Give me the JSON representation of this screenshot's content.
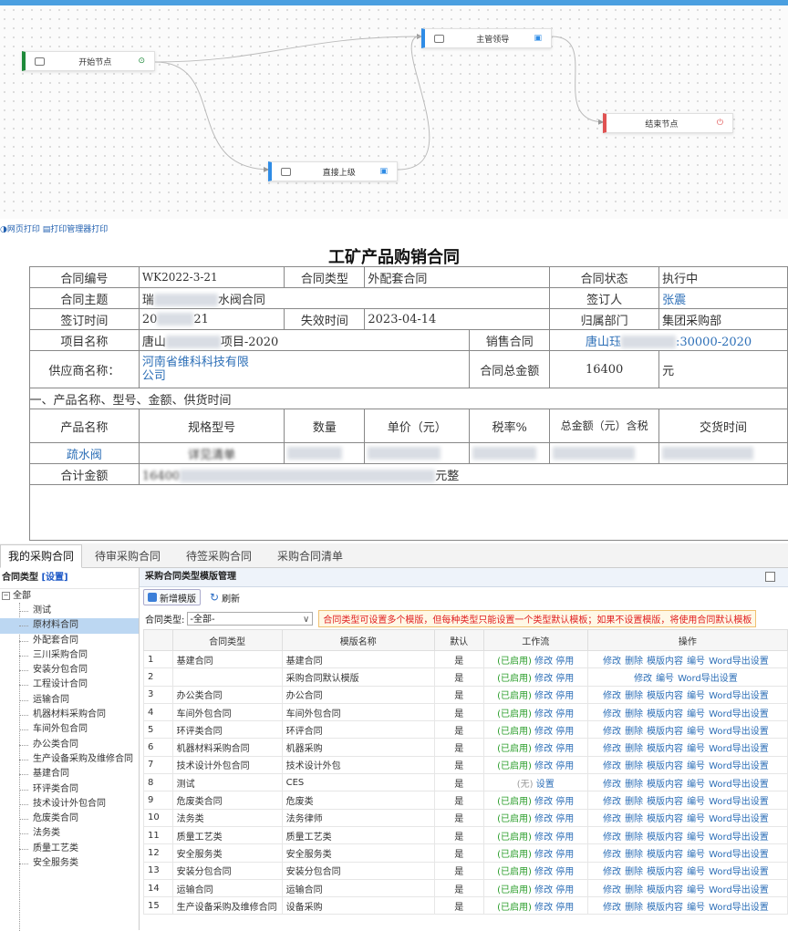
{
  "flow": {
    "nodes": [
      {
        "label": "开始节点",
        "kind": "start"
      },
      {
        "label": "主管领导",
        "kind": "task"
      },
      {
        "label": "结束节点",
        "kind": "end"
      },
      {
        "label": "直接上级",
        "kind": "task"
      }
    ],
    "colors": {
      "start": "#1e8a3a",
      "task": "#2f8ce6",
      "end": "#e05252"
    }
  },
  "print": {
    "web_print": "网页打印",
    "manager_print": "打印管理器打印"
  },
  "contract": {
    "title": "工矿产品购销合同",
    "labels": {
      "no": "合同编号",
      "type": "合同类型",
      "status": "合同状态",
      "subject": "合同主题",
      "signer": "签订人",
      "sign_time": "签订时间",
      "expire_time": "失效时间",
      "dept": "归属部门",
      "project": "项目名称",
      "sales_contract": "销售合同",
      "supplier": "供应商名称：",
      "total": "合同总金额",
      "section": "一、产品名称、型号、金额、供货时间",
      "product": "产品名称",
      "spec": "规格型号",
      "qty": "数量",
      "price": "单价（元）",
      "tax": "税率%",
      "total_tax": "总金额（元）含税",
      "delivery": "交货时间",
      "sum": "合计金额"
    },
    "values": {
      "no": "WK2022-3-21",
      "type": "外配套合同",
      "status": "执行中",
      "subject_a": "瑞",
      "subject_b": "水阀合同",
      "signer": "张震",
      "sign_a": "20",
      "sign_b": "21",
      "expire": "2023-04-14",
      "dept": "集团采购部",
      "project_a": "唐山",
      "project_b": "项目-2020",
      "sales_a": "唐山珏",
      "sales_b": ":30000-2020",
      "supplier_1": "河南省维科科技有限",
      "supplier_2": "公司",
      "total": "16400",
      "unit": "元",
      "product": "疏水阀",
      "spec": "详见清单",
      "sum_a": "16400",
      "sum_b": "元整"
    }
  },
  "tabs": [
    {
      "label": "我的采购合同",
      "active": true
    },
    {
      "label": "待审采购合同",
      "active": false
    },
    {
      "label": "待签采购合同",
      "active": false
    },
    {
      "label": "采购合同清单",
      "active": false
    }
  ],
  "tree": {
    "title": "合同类型",
    "set_label": "[设置]",
    "root": "全部",
    "root_toggle": "−",
    "items": [
      "测试",
      "原材料合同",
      "外配套合同",
      "三川采购合同",
      "安装分包合同",
      "工程设计合同",
      "运输合同",
      "机器材料采购合同",
      "车间外包合同",
      "办公类合同",
      "生产设备采购及维修合同",
      "基建合同",
      "环评类合同",
      "技术设计外包合同",
      "危废类合同",
      "法务类",
      "质量工艺类",
      "安全服务类"
    ],
    "selected": 1
  },
  "panel": {
    "title": "采购合同类型模版管理",
    "add_label": "新增模版",
    "refresh_label": "刷新",
    "filter_label": "合同类型:",
    "filter_value": "-全部-",
    "notice": "合同类型可设置多个模版，但每种类型只能设置一个类型默认模板；如果不设置模版，将使用合同默认模板",
    "headers": [
      "",
      "合同类型",
      "模版名称",
      "默认",
      "工作流",
      "操作"
    ]
  },
  "rows": [
    {
      "n": "1",
      "type": "基建合同",
      "name": "基建合同",
      "def": "是",
      "wf": "enabled"
    },
    {
      "n": "2",
      "type": "",
      "name": "采购合同默认模版",
      "def": "是",
      "wf": "enabled",
      "ops": "short"
    },
    {
      "n": "3",
      "type": "办公类合同",
      "name": "办公合同",
      "def": "是",
      "wf": "enabled"
    },
    {
      "n": "4",
      "type": "车间外包合同",
      "name": "车间外包合同",
      "def": "是",
      "wf": "enabled"
    },
    {
      "n": "5",
      "type": "环评类合同",
      "name": "环评合同",
      "def": "是",
      "wf": "enabled"
    },
    {
      "n": "6",
      "type": "机器材料采购合同",
      "name": "机器采购",
      "def": "是",
      "wf": "enabled"
    },
    {
      "n": "7",
      "type": "技术设计外包合同",
      "name": "技术设计外包",
      "def": "是",
      "wf": "enabled"
    },
    {
      "n": "8",
      "type": "测试",
      "name": "CES",
      "def": "是",
      "wf": "none"
    },
    {
      "n": "9",
      "type": "危废类合同",
      "name": "危废类",
      "def": "是",
      "wf": "enabled"
    },
    {
      "n": "10",
      "type": "法务类",
      "name": "法务律师",
      "def": "是",
      "wf": "enabled"
    },
    {
      "n": "11",
      "type": "质量工艺类",
      "name": "质量工艺类",
      "def": "是",
      "wf": "enabled"
    },
    {
      "n": "12",
      "type": "安全服务类",
      "name": "安全服务类",
      "def": "是",
      "wf": "enabled"
    },
    {
      "n": "13",
      "type": "安装分包合同",
      "name": "安装分包合同",
      "def": "是",
      "wf": "enabled"
    },
    {
      "n": "14",
      "type": "运输合同",
      "name": "运输合同",
      "def": "是",
      "wf": "enabled"
    },
    {
      "n": "15",
      "type": "生产设备采购及维修合同",
      "name": "设备采购",
      "def": "是",
      "wf": "enabled"
    }
  ],
  "wf_text": {
    "enabled": "(已启用)",
    "modify": "修改",
    "stop": "停用",
    "none": "(无)",
    "setup": "设置"
  },
  "ops_text": {
    "edit": "修改",
    "delete": "删除",
    "content": "模版内容",
    "code": "编号",
    "word": "Word导出设置"
  }
}
